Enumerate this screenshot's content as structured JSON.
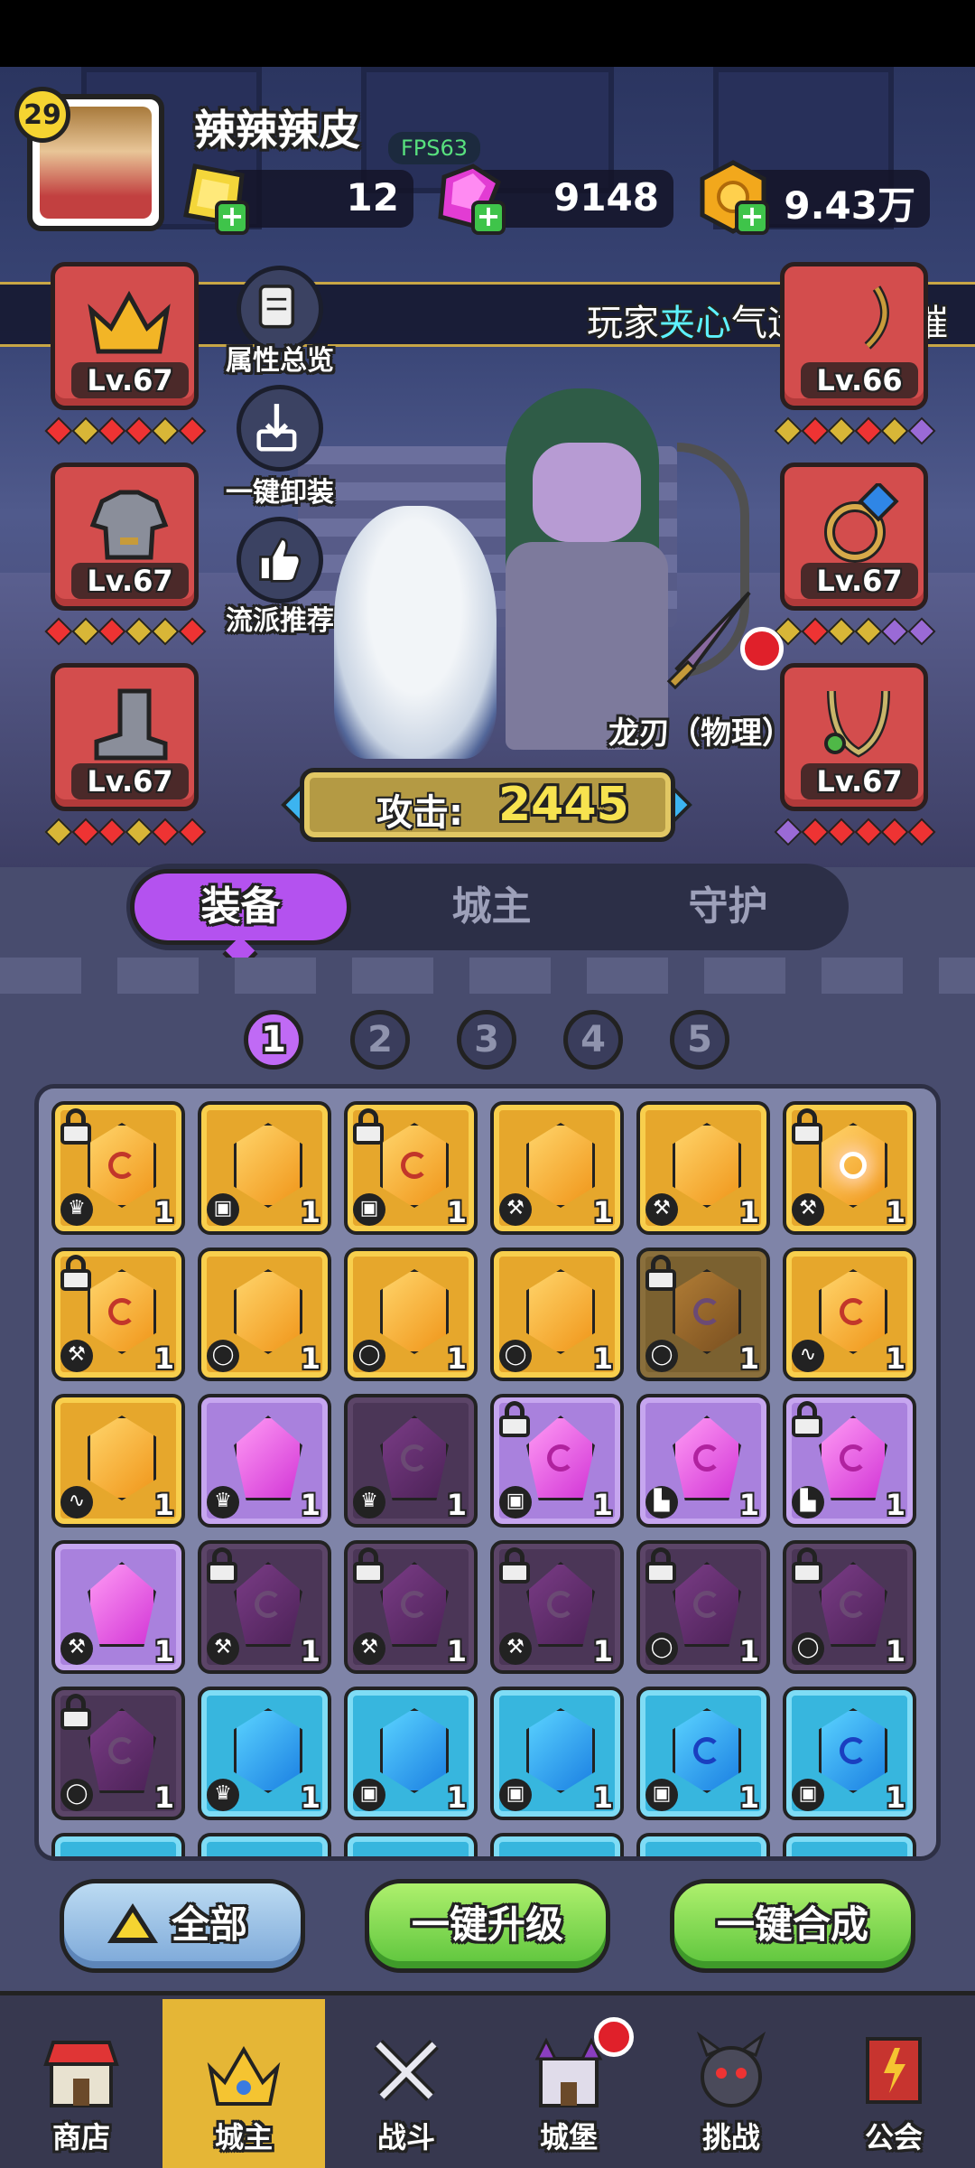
{
  "header": {
    "level": "29",
    "player_name": "辣辣辣皮",
    "fps": "FPS63",
    "currencies": [
      {
        "name": "gold-ticket",
        "value": "12"
      },
      {
        "name": "pink-gem",
        "value": "9148"
      },
      {
        "name": "coin",
        "value": "9.43万"
      }
    ]
  },
  "marquee": {
    "prefix": "玩家",
    "highlight": "夹心",
    "suffix": "气运惊人，璀"
  },
  "side_buttons": [
    "属性总览",
    "一键卸装",
    "流派推荐"
  ],
  "slots": {
    "left": [
      {
        "icon": "crown-icon",
        "level": "Lv.67"
      },
      {
        "icon": "armor-icon",
        "level": "Lv.67"
      },
      {
        "icon": "boots-icon",
        "level": "Lv.67"
      }
    ],
    "right": [
      {
        "icon": "weapon-icon",
        "level": "Lv.66"
      },
      {
        "icon": "ring-icon",
        "level": "Lv.67"
      },
      {
        "icon": "necklace-icon",
        "level": "Lv.67"
      }
    ]
  },
  "weapon_label": "龙刃（物理）",
  "attack": {
    "label": "攻击:",
    "value": "2445"
  },
  "tabs": [
    "装备",
    "城主",
    "守护"
  ],
  "pages": [
    "1",
    "2",
    "3",
    "4",
    "5"
  ],
  "grid": [
    {
      "bg": "gold",
      "gem": "orange",
      "shape": "hex",
      "swirl": "red",
      "tag": "♛",
      "count": "1",
      "locked": true
    },
    {
      "bg": "gold",
      "gem": "orange",
      "shape": "hex",
      "swirl": "",
      "tag": "▣",
      "count": "1",
      "locked": false
    },
    {
      "bg": "gold",
      "gem": "orange",
      "shape": "hex",
      "swirl": "red",
      "tag": "▣",
      "count": "1",
      "locked": true
    },
    {
      "bg": "gold",
      "gem": "orange",
      "shape": "hex",
      "swirl": "",
      "tag": "⚒",
      "count": "1",
      "locked": false
    },
    {
      "bg": "gold",
      "gem": "orange",
      "shape": "hex",
      "swirl": "",
      "tag": "⚒",
      "count": "1",
      "locked": false
    },
    {
      "bg": "gold",
      "gem": "orange",
      "shape": "hex",
      "swirl": "burst",
      "tag": "⚒",
      "count": "1",
      "locked": true
    },
    {
      "bg": "gold",
      "gem": "orange",
      "shape": "hex",
      "swirl": "red",
      "tag": "⚒",
      "count": "1",
      "locked": true
    },
    {
      "bg": "gold",
      "gem": "orange",
      "shape": "hex",
      "swirl": "",
      "tag": "◯",
      "count": "1",
      "locked": false
    },
    {
      "bg": "gold",
      "gem": "orange",
      "shape": "hex",
      "swirl": "",
      "tag": "◯",
      "count": "1",
      "locked": false
    },
    {
      "bg": "gold",
      "gem": "orange",
      "shape": "hex",
      "swirl": "",
      "tag": "◯",
      "count": "1",
      "locked": false
    },
    {
      "bg": "dgold",
      "gem": "dor",
      "shape": "hex",
      "swirl": "dk",
      "tag": "◯",
      "count": "1",
      "locked": true
    },
    {
      "bg": "gold",
      "gem": "orange",
      "shape": "hex",
      "swirl": "red",
      "tag": "∿",
      "count": "1",
      "locked": false
    },
    {
      "bg": "gold",
      "gem": "orange",
      "shape": "hex",
      "swirl": "",
      "tag": "∿",
      "count": "1",
      "locked": false
    },
    {
      "bg": "purple",
      "gem": "magenta",
      "shape": "pent",
      "swirl": "",
      "tag": "♛",
      "count": "1",
      "locked": false
    },
    {
      "bg": "dpurple",
      "gem": "dmag",
      "shape": "pent",
      "swirl": "dk",
      "tag": "♛",
      "count": "1",
      "locked": false
    },
    {
      "bg": "purple",
      "gem": "magenta",
      "shape": "pent",
      "swirl": "pk",
      "tag": "▣",
      "count": "1",
      "locked": true
    },
    {
      "bg": "purple",
      "gem": "magenta",
      "shape": "pent",
      "swirl": "pk",
      "tag": "▙",
      "count": "1",
      "locked": false
    },
    {
      "bg": "purple",
      "gem": "magenta",
      "shape": "pent",
      "swirl": "pk",
      "tag": "▙",
      "count": "1",
      "locked": true
    },
    {
      "bg": "purple",
      "gem": "magenta",
      "shape": "pent",
      "swirl": "",
      "tag": "⚒",
      "count": "1",
      "locked": false
    },
    {
      "bg": "dpurple",
      "gem": "dmag",
      "shape": "pent",
      "swirl": "dk",
      "tag": "⚒",
      "count": "1",
      "locked": true
    },
    {
      "bg": "dpurple",
      "gem": "dmag",
      "shape": "pent",
      "swirl": "dk",
      "tag": "⚒",
      "count": "1",
      "locked": true
    },
    {
      "bg": "dpurple",
      "gem": "dmag",
      "shape": "pent",
      "swirl": "dk",
      "tag": "⚒",
      "count": "1",
      "locked": true
    },
    {
      "bg": "dpurple",
      "gem": "dmag",
      "shape": "pent",
      "swirl": "dk",
      "tag": "◯",
      "count": "1",
      "locked": true
    },
    {
      "bg": "dpurple",
      "gem": "dmag",
      "shape": "pent",
      "swirl": "dk",
      "tag": "◯",
      "count": "1",
      "locked": true
    },
    {
      "bg": "dpurple",
      "gem": "dmag",
      "shape": "pent",
      "swirl": "dk",
      "tag": "◯",
      "count": "1",
      "locked": true
    },
    {
      "bg": "blue",
      "gem": "bl",
      "shape": "hex",
      "swirl": "",
      "tag": "♛",
      "count": "1",
      "locked": false
    },
    {
      "bg": "blue",
      "gem": "bl",
      "shape": "hex",
      "swirl": "",
      "tag": "▣",
      "count": "1",
      "locked": false
    },
    {
      "bg": "blue",
      "gem": "bl",
      "shape": "hex",
      "swirl": "",
      "tag": "▣",
      "count": "1",
      "locked": false
    },
    {
      "bg": "blue",
      "gem": "bl",
      "shape": "hex",
      "swirl": "bl",
      "tag": "▣",
      "count": "1",
      "locked": false
    },
    {
      "bg": "blue",
      "gem": "bl",
      "shape": "hex",
      "swirl": "bl",
      "tag": "▣",
      "count": "1",
      "locked": false
    }
  ],
  "actions": [
    "全部",
    "一键升级",
    "一键合成"
  ],
  "nav": [
    {
      "label": "商店",
      "icon": "shop-icon"
    },
    {
      "label": "城主",
      "icon": "lord-icon"
    },
    {
      "label": "战斗",
      "icon": "swords-icon"
    },
    {
      "label": "城堡",
      "icon": "castle-icon"
    },
    {
      "label": "挑战",
      "icon": "demon-icon"
    },
    {
      "label": "公会",
      "icon": "guild-icon"
    }
  ],
  "colors": {
    "accent_purple": "#b452ef",
    "gold": "#e5b636",
    "panel": "#484c6e"
  }
}
